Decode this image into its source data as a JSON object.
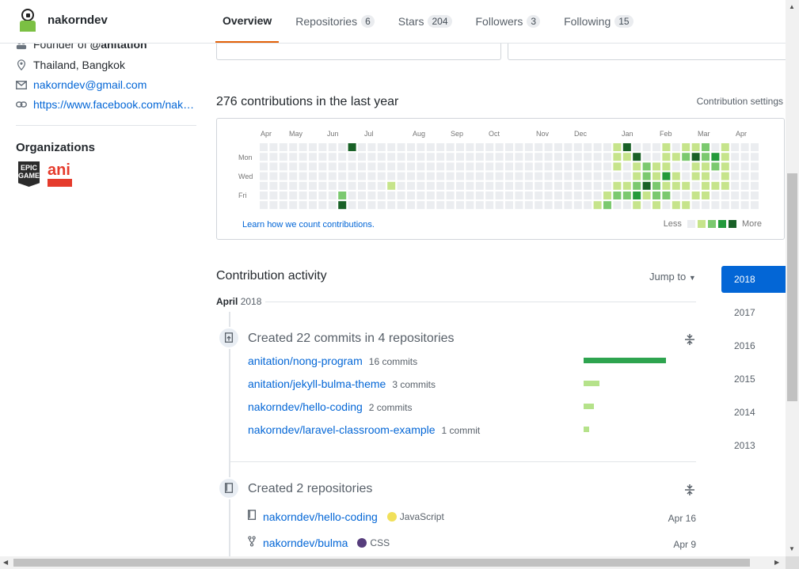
{
  "header": {
    "username": "nakorndev",
    "tabs": [
      {
        "label": "Overview",
        "count": null
      },
      {
        "label": "Repositories",
        "count": "6"
      },
      {
        "label": "Stars",
        "count": "204"
      },
      {
        "label": "Followers",
        "count": "3"
      },
      {
        "label": "Following",
        "count": "15"
      }
    ]
  },
  "sidebar": {
    "founder_prefix": "Founder of ",
    "founder_org": "@anitation",
    "location": "Thailand, Bangkok",
    "email": "nakorndev@gmail.com",
    "website": "https://www.facebook.com/nak…",
    "organizations_title": "Organizations",
    "orgs": {
      "epic": "EPIC GAMES",
      "ani": "ani"
    }
  },
  "contributions": {
    "title": "276 contributions in the last year",
    "settings": "Contribution settings",
    "months": [
      "Apr",
      "May",
      "Jun",
      "Jul",
      "Aug",
      "Sep",
      "Oct",
      "Nov",
      "Dec",
      "Jan",
      "Feb",
      "Mar",
      "Apr"
    ],
    "days": [
      "Mon",
      "Wed",
      "Fri"
    ],
    "learn_link": "Learn how we count contributions.",
    "legend_less": "Less",
    "legend_more": "More",
    "colors": [
      "#ebedf0",
      "#c6e48b",
      "#7bc96f",
      "#239a3b",
      "#196127"
    ]
  },
  "activity": {
    "title": "Contribution activity",
    "jump_to": "Jump to",
    "month": "April",
    "month_year": "2018",
    "commits_group": {
      "title": "Created 22 commits in 4 repositories",
      "repos": [
        {
          "name": "anitation/nong-program",
          "count": "16 commits",
          "share": 16
        },
        {
          "name": "anitation/jekyll-bulma-theme",
          "count": "3 commits",
          "share": 3
        },
        {
          "name": "nakorndev/hello-coding",
          "count": "2 commits",
          "share": 2
        },
        {
          "name": "nakorndev/laravel-classroom-example",
          "count": "1 commit",
          "share": 1
        }
      ]
    },
    "repos_group": {
      "title": "Created 2 repositories",
      "repos": [
        {
          "name": "nakorndev/hello-coding",
          "language": "JavaScript",
          "lang_color": "#f1e05a",
          "date": "Apr 16"
        },
        {
          "name": "nakorndev/bulma",
          "language": "CSS",
          "lang_color": "#563d7c",
          "date": "Apr 9"
        }
      ]
    }
  },
  "years": [
    "2018",
    "2017",
    "2016",
    "2015",
    "2014",
    "2013"
  ]
}
